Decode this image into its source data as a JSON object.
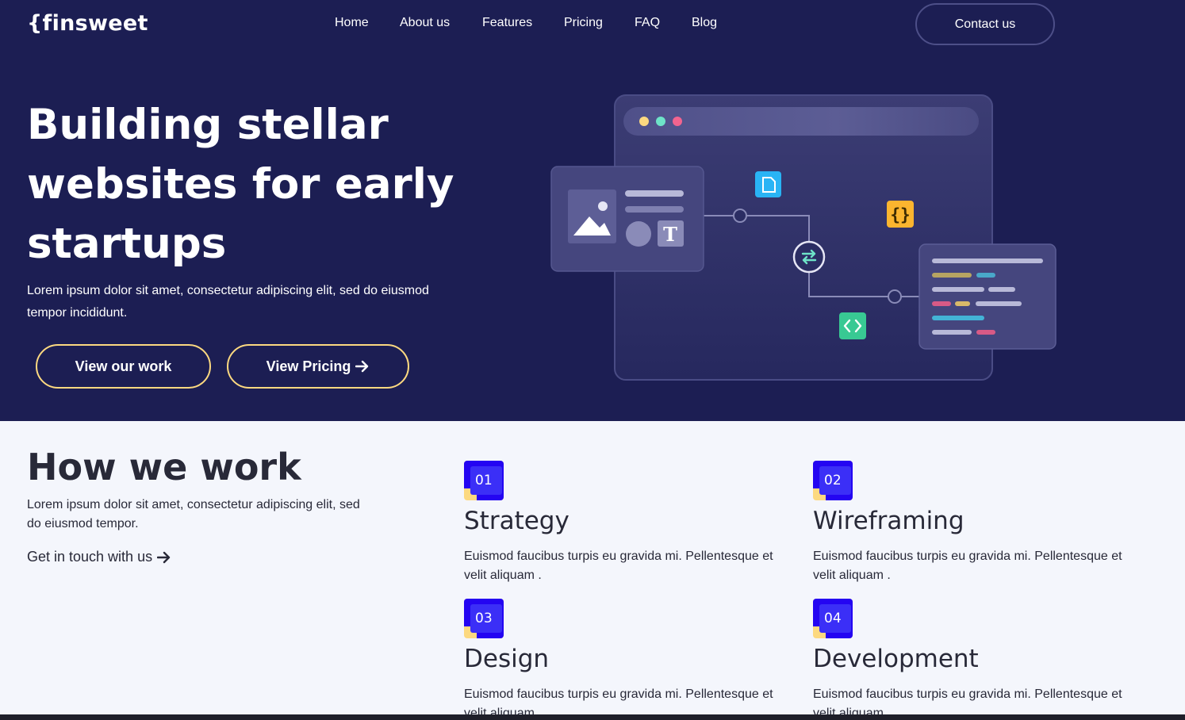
{
  "brand": {
    "logo_text": "{finsweet"
  },
  "nav": {
    "items": [
      {
        "label": "Home"
      },
      {
        "label": "About us"
      },
      {
        "label": "Features"
      },
      {
        "label": "Pricing"
      },
      {
        "label": "FAQ"
      },
      {
        "label": "Blog"
      }
    ],
    "contact_label": "Contact us"
  },
  "hero": {
    "title": "Building stellar websites for early startups",
    "subtitle": "Lorem ipsum dolor sit amet, consectetur adipiscing elit, sed do eiusmod tempor incididunt.",
    "primary_cta": "View our work",
    "secondary_cta": "View Pricing"
  },
  "how_we_work": {
    "title": "How we work",
    "description": "Lorem ipsum dolor sit amet, consectetur adipiscing elit, sed do eiusmod tempor.",
    "link_label": "Get in touch with us",
    "steps": [
      {
        "number": "01",
        "name": "Strategy",
        "description": "Euismod faucibus turpis eu gravida mi. Pellentesque et velit aliquam ."
      },
      {
        "number": "02",
        "name": "Wireframing",
        "description": "Euismod faucibus turpis eu gravida mi. Pellentesque et velit aliquam ."
      },
      {
        "number": "03",
        "name": "Design",
        "description": "Euismod faucibus turpis eu gravida mi. Pellentesque et velit aliquam ."
      },
      {
        "number": "04",
        "name": "Development",
        "description": "Euismod faucibus turpis eu gravida mi. Pellentesque et velit aliquam ."
      }
    ]
  },
  "colors": {
    "hero_bg": "#1c1e53",
    "accent_yellow": "#fcd980",
    "accent_blue": "#2405f2",
    "text_dark": "#282938",
    "section_bg": "#f4f6fc"
  },
  "icons": [
    "image-icon",
    "text-icon",
    "file-icon",
    "code-braces-icon",
    "sync-icon",
    "code-icon",
    "arrow-right-icon"
  ]
}
